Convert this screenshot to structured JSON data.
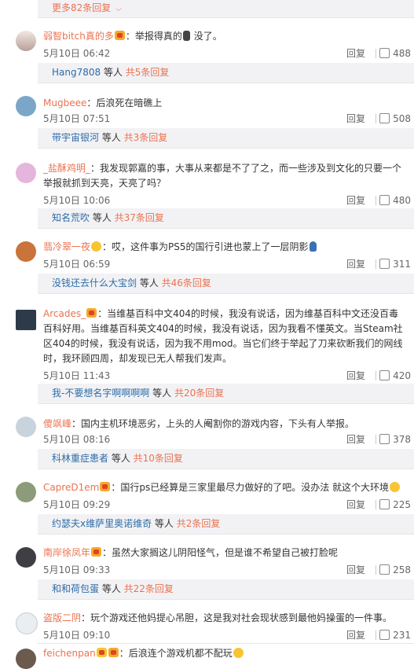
{
  "top_more": "更多82条回复",
  "reply_label": "回复",
  "comments": [
    {
      "user": "弱智bitch真的多",
      "text": "：举报得真的",
      "text2": " 没了。",
      "time": "5月10日 06:42",
      "likes": "488",
      "sub_user": "Hang7808",
      "sub_mid": " 等人 ",
      "sub_count": "共5条回复"
    },
    {
      "user": "Mugbeee",
      "text": "：后浪死在暗礁上",
      "time": "5月10日 07:51",
      "likes": "508",
      "sub_user": "带宇宙银河",
      "sub_mid": " 等人 ",
      "sub_count": "共3条回复"
    },
    {
      "user": "_盐酥鸡明_",
      "text": "：我发现郭嘉的事，大事从来都是不了了之，而一些涉及到文化的只要一个举报就抓到天亮，天亮了吗？",
      "time": "5月10日 10:06",
      "likes": "480",
      "sub_user": "知名荒吹",
      "sub_mid": " 等人 ",
      "sub_count": "共37条回复"
    },
    {
      "user": "翡冷翠一夜",
      "text": "：哎，这件事为PS5的国行引进也蒙上了一层阴影",
      "time": "5月10日 06:59",
      "likes": "311",
      "sub_user": "没钱还去什么大宝剑",
      "sub_mid": " 等人 ",
      "sub_count": "共46条回复"
    },
    {
      "user": "Arcades_",
      "text": "：当维基百科中文404的时候，我没有说话，因为维基百科中文还没百毒百科好用。当维基百科英文404的时候，我没有说话，因为我看不懂英文。当Steam社区404的时候，我没有说话，因为我不用mod。当它们终于举起了刀来砍断我们的网线时，我环顾四周，却发现已无人帮我们发声。",
      "time": "5月10日 11:43",
      "likes": "420",
      "sub_user": "我-不要想名字啊啊啊啊",
      "sub_mid": " 等人 ",
      "sub_count": "共20条回复"
    },
    {
      "user": "傻飒峰",
      "text": "：国内主机环境恶劣，上头的人阉割你的游戏内容，下头有人举报。",
      "time": "5月10日 08:16",
      "likes": "378",
      "sub_user": "科林重症患者",
      "sub_mid": " 等人 ",
      "sub_count": "共10条回复"
    },
    {
      "user": "CapreD1em",
      "text": "：国行ps已经算是三家里最尽力做好的了吧。没办法 就这个大环境",
      "time": "5月10日 09:29",
      "likes": "225",
      "sub_user": "约瑟夫x维萨里奥诺维奇",
      "sub_mid": " 等人 ",
      "sub_count": "共2条回复"
    },
    {
      "user": "南岸徐凤年",
      "text": "：虽然大家搁这儿阴阳怪气，但是谁不希望自己被打脸呢",
      "time": "5月10日 09:33",
      "likes": "258",
      "sub_user": "和和荷包蛋",
      "sub_mid": " 等人 ",
      "sub_count": "共22条回复"
    },
    {
      "user": "盗版二阴",
      "text": "：玩个游戏还他妈提心吊胆，这是我对社会现状感到最他妈操蛋的一件事。",
      "time": "5月10日 09:10",
      "likes": "231"
    },
    {
      "user": "feichenpan",
      "text": "：后浪连个游戏机都不配玩"
    }
  ],
  "colors": {
    "link": "#eb7350",
    "user_blue": "#2e6ca6",
    "bar_bg": "#f2f2f5"
  }
}
